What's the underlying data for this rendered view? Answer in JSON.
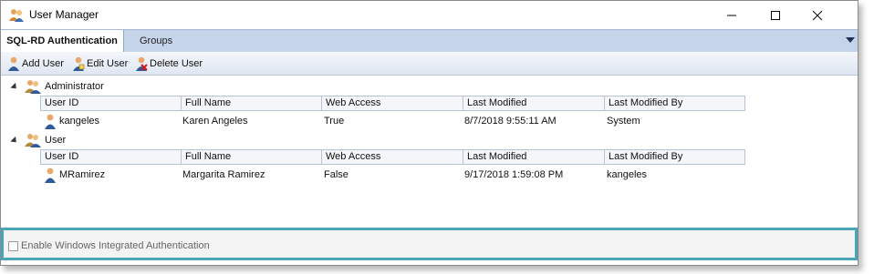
{
  "window": {
    "title": "User Manager"
  },
  "tabs": [
    {
      "label": "SQL-RD Authentication",
      "active": true
    },
    {
      "label": "Groups",
      "active": false
    }
  ],
  "toolbar": {
    "add_label": "Add User",
    "edit_label": "Edit User",
    "delete_label": "Delete User"
  },
  "columns": [
    "User ID",
    "Full Name",
    "Web Access",
    "Last Modified",
    "Last Modified By"
  ],
  "groups": [
    {
      "name": "Administrator",
      "users": [
        {
          "user_id": "kangeles",
          "full_name": "Karen Angeles",
          "web_access": "True",
          "last_modified": "8/7/2018 9:55:11 AM",
          "last_modified_by": "System"
        }
      ]
    },
    {
      "name": "User",
      "users": [
        {
          "user_id": "MRamirez",
          "full_name": "Margarita Ramirez",
          "web_access": "False",
          "last_modified": "9/17/2018 1:59:08 PM",
          "last_modified_by": "kangeles"
        }
      ]
    }
  ],
  "footer": {
    "checkbox_label": "Enable Windows Integrated Authentication",
    "checked": false
  },
  "colors": {
    "tab_strip": "#c6d4ea",
    "footer_border": "#4aa6b6"
  }
}
